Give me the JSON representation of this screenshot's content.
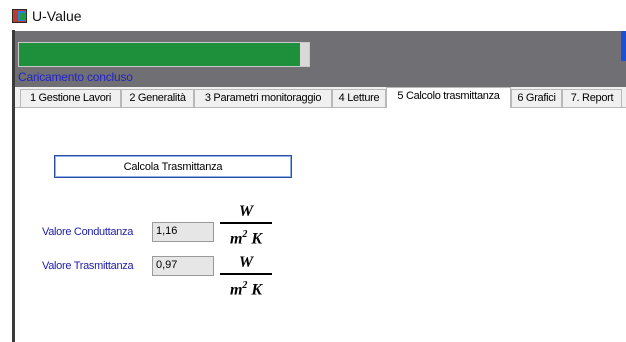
{
  "window": {
    "title": "U-Value",
    "icon": "app-window-icon"
  },
  "progress": {
    "fraction": 0.97,
    "fill_color": "#1e8f3a"
  },
  "status": {
    "text": "Caricamento concluso",
    "color": "#2323c8"
  },
  "tabs": [
    {
      "label": "1 Gestione Lavori",
      "active": false
    },
    {
      "label": "2 Generalità",
      "active": false
    },
    {
      "label": "3 Parametri monitoraggio",
      "active": false
    },
    {
      "label": "4 Letture",
      "active": false
    },
    {
      "label": "5 Calcolo trasmittanza",
      "active": true
    },
    {
      "label": "6 Grafici",
      "active": false
    },
    {
      "label": "7. Report",
      "active": false
    }
  ],
  "calc_button": {
    "label": "Calcola Trasmittanza"
  },
  "conductance": {
    "label": "Valore Conduttanza",
    "value": "1,16"
  },
  "transmittance": {
    "label": "Valore Trasmittanza",
    "value": "0,97"
  },
  "units": {
    "numerator": "W",
    "denominator_base": "m",
    "denominator_exp": "2",
    "denominator_tail": "K"
  }
}
